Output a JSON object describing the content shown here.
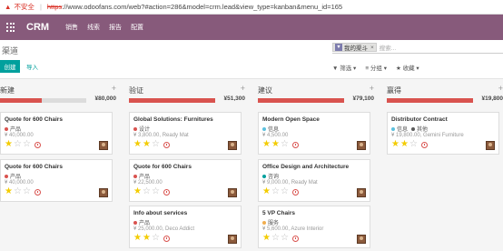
{
  "browser": {
    "warning": "▲",
    "insecure": "不安全",
    "separator": "|",
    "scheme": "https",
    "url_rest": "://www.odoofans.com/web?#action=286&model=crm.lead&view_type=kanban&menu_id=165"
  },
  "app": {
    "brand": "CRM",
    "menu": [
      "销售",
      "线索",
      "报告",
      "配置"
    ]
  },
  "breadcrumb": "渠道",
  "search": {
    "facet_icon": "▼",
    "facet_label": "我的渠斗",
    "facet_close": "×",
    "placeholder": "搜索..."
  },
  "buttons": {
    "create": "创建",
    "import": "导入"
  },
  "filters": [
    "▼ 筛选 ▾",
    "≡ 分组 ▾",
    "★ 收藏 ▾"
  ],
  "columns": [
    {
      "title": "新建",
      "plus": "+",
      "total": "¥80,000",
      "progress": 0.48,
      "cards": [
        {
          "title": "Quote for 600 Chairs",
          "tags": [
            {
              "label": "产品",
              "color": "#d9534f"
            }
          ],
          "amount": "¥ 40,000.00",
          "stars": 1
        },
        {
          "title": "Quote for 600 Chairs",
          "tags": [
            {
              "label": "产品",
              "color": "#d9534f"
            }
          ],
          "amount": "¥ 40,000.00",
          "stars": 1
        }
      ]
    },
    {
      "title": "验证",
      "plus": "+",
      "total": "¥51,300",
      "progress": 1.0,
      "cards": [
        {
          "title": "Global Solutions: Furnitures",
          "tags": [
            {
              "label": "设计",
              "color": "#d9534f"
            }
          ],
          "amount": "¥ 3,800.00, Ready Mat",
          "stars": 2
        },
        {
          "title": "Quote for 600 Chairs",
          "tags": [
            {
              "label": "产品",
              "color": "#d9534f"
            }
          ],
          "amount": "¥ 22,500.00",
          "stars": 1
        },
        {
          "title": "Info about services",
          "tags": [
            {
              "label": "产品",
              "color": "#d9534f"
            }
          ],
          "amount": "¥ 25,000.00, Deco Addict",
          "stars": 2
        }
      ]
    },
    {
      "title": "建议",
      "plus": "+",
      "total": "¥79,100",
      "progress": 1.0,
      "cards": [
        {
          "title": "Modern Open Space",
          "tags": [
            {
              "label": "信息",
              "color": "#5bc0de"
            }
          ],
          "amount": "¥ 4,500.00",
          "stars": 2
        },
        {
          "title": "Office Design and Architecture",
          "tags": [
            {
              "label": "咨询",
              "color": "#00a09d"
            }
          ],
          "amount": "¥ 9,000.00, Ready Mat",
          "stars": 1
        },
        {
          "title": "5 VP Chairs",
          "tags": [
            {
              "label": "服务",
              "color": "#f0ad4e"
            }
          ],
          "amount": "¥ 5,600.00, Azure Interior",
          "stars": 1
        }
      ]
    },
    {
      "title": "赢得",
      "plus": "+",
      "total": "¥19,800",
      "progress": 1.0,
      "cards": [
        {
          "title": "Distributor Contract",
          "tags": [
            {
              "label": "信息",
              "color": "#5bc0de"
            },
            {
              "label": "其他",
              "color": "#5a5a5a"
            }
          ],
          "amount": "¥ 19,800.00, Gemini Furniture",
          "stars": 2
        }
      ]
    }
  ],
  "icons": {
    "star": "★",
    "star_empty": "☆",
    "apps": "grid-icon",
    "clock": "clock-icon",
    "avatar": "avatar"
  },
  "colors": {
    "primary": "#875a7b",
    "accent": "#00a09d",
    "danger": "#d9534f",
    "star": "#f3cc00"
  }
}
